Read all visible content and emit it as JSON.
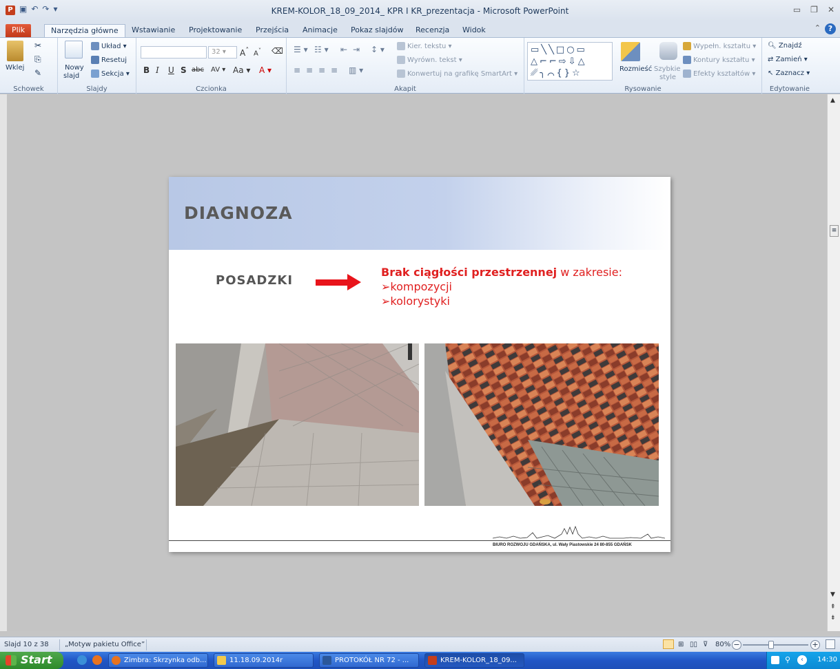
{
  "window": {
    "title": "KREM-KOLOR_18_09_2014_ KPR I KR_prezentacja  -  Microsoft PowerPoint"
  },
  "ribbon_tabs": [
    "Plik",
    "Narzędzia główne",
    "Wstawianie",
    "Projektowanie",
    "Przejścia",
    "Animacje",
    "Pokaz slajdów",
    "Recenzja",
    "Widok"
  ],
  "ribbon": {
    "schowek": {
      "label": "Schowek",
      "paste": "Wklej"
    },
    "slajdy": {
      "label": "Slajdy",
      "new_slide_1": "Nowy",
      "new_slide_2": "slajd",
      "layout": "Układ",
      "reset": "Resetuj",
      "section": "Sekcja"
    },
    "czcionka": {
      "label": "Czcionka",
      "font_size": "32"
    },
    "akapit": {
      "label": "Akapit",
      "text_dir": "Kier. tekstu",
      "align_text": "Wyrówn. tekst",
      "smartart": "Konwertuj na grafikę SmartArt"
    },
    "rysowanie": {
      "label": "Rysowanie",
      "arrange": "Rozmieść",
      "quick_styles_1": "Szybkie",
      "quick_styles_2": "style",
      "fill": "Wypełn. kształtu",
      "outline": "Kontury kształtu",
      "effects": "Efekty kształtów"
    },
    "edytowanie": {
      "label": "Edytowanie",
      "find": "Znajdź",
      "replace": "Zamień",
      "select": "Zaznacz"
    }
  },
  "slide": {
    "title": "DIAGNOZA",
    "subject": "POSADZKI",
    "diag_bold": "Brak ciągłości przestrzennej",
    "diag_rest": " w zakresie:",
    "bullet_char": "➢",
    "bullets": [
      "kompozycji",
      "kolorystyki"
    ],
    "footer": "BIURO ROZWOJU GDAŃSKA, ul. Wały Piastowskie 24  80-855 GDAŃSK"
  },
  "statusbar": {
    "slide_info": "Slajd 10 z 38",
    "theme": "„Motyw pakietu Office”",
    "zoom": "80%"
  },
  "taskbar": {
    "start": "Start",
    "tasks": [
      "Zimbra: Skrzynka odb...",
      "11.18.09.2014r",
      "PROTOKÓŁ NR  72 - ...",
      "KREM-KOLOR_18_09..."
    ],
    "clock": "14:30"
  },
  "colors": {
    "accent_red": "#e02020",
    "ribbon_blue": "#dbe3ee",
    "file_tab": "#c1391a"
  }
}
